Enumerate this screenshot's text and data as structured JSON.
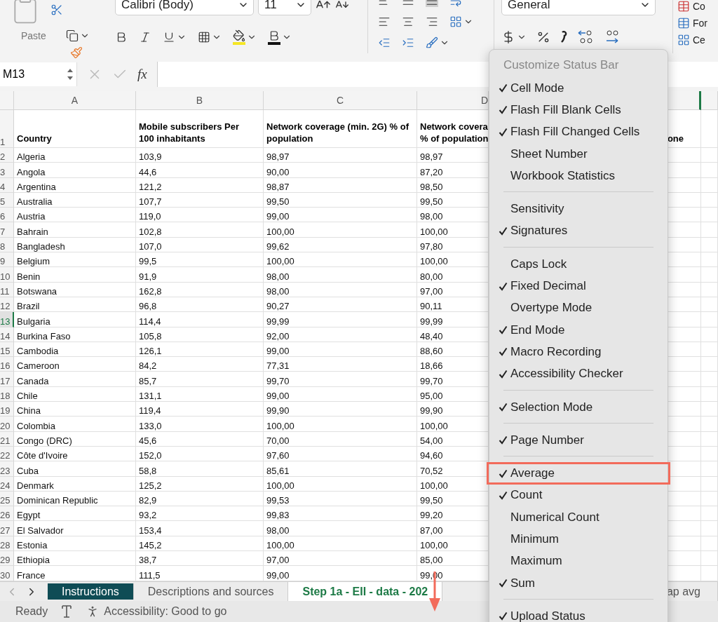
{
  "ribbon": {
    "paste_label": "Paste",
    "font_name": "Calibri (Body)",
    "font_size": "11",
    "number_format": "General",
    "style_labels": [
      "Co",
      "For",
      "Ce"
    ]
  },
  "formula_bar": {
    "name_box": "M13",
    "fx": "fx"
  },
  "sheet": {
    "column_letters": [
      "A",
      "B",
      "C",
      "D"
    ],
    "header_row": {
      "number": "1",
      "cells": [
        [
          "Country"
        ],
        [
          "Mobile subscribers Per",
          "100 inhabitants"
        ],
        [
          "Network coverage (min. 2G) % of",
          "population"
        ],
        [
          "Network covera",
          "% of population"
        ]
      ],
      "column_5": "one"
    },
    "rows": [
      {
        "number": "2",
        "selected": false,
        "cells": [
          "Algeria",
          "103,9",
          "98,97",
          "98,97"
        ]
      },
      {
        "number": "3",
        "selected": false,
        "cells": [
          "Angola",
          "44,6",
          "90,00",
          "87,20"
        ]
      },
      {
        "number": "4",
        "selected": false,
        "cells": [
          "Argentina",
          "121,2",
          "98,87",
          "98,50"
        ]
      },
      {
        "number": "5",
        "selected": false,
        "cells": [
          "Australia",
          "107,7",
          "99,50",
          "99,50"
        ]
      },
      {
        "number": "6",
        "selected": false,
        "cells": [
          "Austria",
          "119,0",
          "99,00",
          "98,00"
        ]
      },
      {
        "number": "7",
        "selected": false,
        "cells": [
          "Bahrain",
          "102,8",
          "100,00",
          "100,00"
        ]
      },
      {
        "number": "8",
        "selected": false,
        "cells": [
          "Bangladesh",
          "107,0",
          "99,62",
          "97,80"
        ]
      },
      {
        "number": "9",
        "selected": false,
        "cells": [
          "Belgium",
          "99,5",
          "100,00",
          "100,00"
        ]
      },
      {
        "number": "10",
        "selected": false,
        "cells": [
          "Benin",
          "91,9",
          "98,00",
          "80,00"
        ]
      },
      {
        "number": "11",
        "selected": false,
        "cells": [
          "Botswana",
          "162,8",
          "98,00",
          "97,00"
        ]
      },
      {
        "number": "12",
        "selected": false,
        "cells": [
          "Brazil",
          "96,8",
          "90,27",
          "90,11"
        ]
      },
      {
        "number": "13",
        "selected": true,
        "cells": [
          "Bulgaria",
          "114,4",
          "99,99",
          "99,99"
        ]
      },
      {
        "number": "14",
        "selected": false,
        "cells": [
          "Burkina Faso",
          "105,8",
          "92,00",
          "48,40"
        ]
      },
      {
        "number": "15",
        "selected": false,
        "cells": [
          "Cambodia",
          "126,1",
          "99,00",
          "88,60"
        ]
      },
      {
        "number": "16",
        "selected": false,
        "cells": [
          "Cameroon",
          "84,2",
          "77,31",
          "18,66"
        ]
      },
      {
        "number": "17",
        "selected": false,
        "cells": [
          "Canada",
          "85,7",
          "99,70",
          "99,70"
        ]
      },
      {
        "number": "18",
        "selected": false,
        "cells": [
          "Chile",
          "131,1",
          "99,00",
          "95,00"
        ]
      },
      {
        "number": "19",
        "selected": false,
        "cells": [
          "China",
          "119,4",
          "99,90",
          "99,90"
        ]
      },
      {
        "number": "20",
        "selected": false,
        "cells": [
          "Colombia",
          "133,0",
          "100,00",
          "100,00"
        ]
      },
      {
        "number": "21",
        "selected": false,
        "cells": [
          "Congo (DRC)",
          "45,6",
          "70,00",
          "54,00"
        ]
      },
      {
        "number": "22",
        "selected": false,
        "cells": [
          "Côte d'Ivoire",
          "152,0",
          "97,60",
          "94,60"
        ]
      },
      {
        "number": "23",
        "selected": false,
        "cells": [
          "Cuba",
          "58,8",
          "85,61",
          "70,52"
        ]
      },
      {
        "number": "24",
        "selected": false,
        "cells": [
          "Denmark",
          "125,2",
          "100,00",
          "100,00"
        ]
      },
      {
        "number": "25",
        "selected": false,
        "cells": [
          "Dominican Republic",
          "82,9",
          "99,53",
          "99,50"
        ]
      },
      {
        "number": "26",
        "selected": false,
        "cells": [
          "Egypt",
          "93,2",
          "99,83",
          "99,20"
        ]
      },
      {
        "number": "27",
        "selected": false,
        "cells": [
          "El Salvador",
          "153,4",
          "98,00",
          "87,00"
        ]
      },
      {
        "number": "28",
        "selected": false,
        "cells": [
          "Estonia",
          "145,2",
          "100,00",
          "100,00"
        ]
      },
      {
        "number": "29",
        "selected": false,
        "cells": [
          "Ethiopia",
          "38,7",
          "97,00",
          "85,00"
        ]
      },
      {
        "number": "30",
        "selected": false,
        "cells": [
          "France",
          "111,5",
          "99,00",
          "99,00"
        ]
      }
    ]
  },
  "sheet_tabs": [
    {
      "label": "Instructions",
      "selected": false,
      "color": "#0f4c55"
    },
    {
      "label": "Descriptions and sources",
      "selected": false
    },
    {
      "label": "Step 1a - EII - data - 202",
      "selected": true
    },
    {
      "label": "ap avg",
      "selected": false
    }
  ],
  "status_bar": {
    "mode": "Ready",
    "accessibility": "Accessibility: Good to go"
  },
  "menu": {
    "title": "Customize Status Bar",
    "groups": [
      [
        {
          "label": "Cell Mode",
          "checked": true,
          "highlighted": false
        },
        {
          "label": "Flash Fill Blank Cells",
          "checked": true,
          "highlighted": false
        },
        {
          "label": "Flash Fill Changed Cells",
          "checked": true,
          "highlighted": false
        },
        {
          "label": "Sheet Number",
          "checked": false,
          "highlighted": false
        },
        {
          "label": "Workbook Statistics",
          "checked": false,
          "highlighted": false
        }
      ],
      [
        {
          "label": "Sensitivity",
          "checked": false,
          "highlighted": false
        },
        {
          "label": "Signatures",
          "checked": true,
          "highlighted": false
        }
      ],
      [
        {
          "label": "Caps Lock",
          "checked": false,
          "highlighted": false
        },
        {
          "label": "Fixed Decimal",
          "checked": true,
          "highlighted": false
        },
        {
          "label": "Overtype Mode",
          "checked": false,
          "highlighted": false
        },
        {
          "label": "End Mode",
          "checked": true,
          "highlighted": false
        },
        {
          "label": "Macro Recording",
          "checked": true,
          "highlighted": false
        },
        {
          "label": "Accessibility Checker",
          "checked": true,
          "highlighted": false
        }
      ],
      [
        {
          "label": "Selection Mode",
          "checked": true,
          "highlighted": false
        }
      ],
      [
        {
          "label": "Page Number",
          "checked": true,
          "highlighted": false
        }
      ],
      [
        {
          "label": "Average",
          "checked": true,
          "highlighted": true
        },
        {
          "label": "Count",
          "checked": true,
          "highlighted": false
        },
        {
          "label": "Numerical Count",
          "checked": false,
          "highlighted": false
        },
        {
          "label": "Minimum",
          "checked": false,
          "highlighted": false
        },
        {
          "label": "Maximum",
          "checked": false,
          "highlighted": false
        },
        {
          "label": "Sum",
          "checked": true,
          "highlighted": false
        }
      ],
      [
        {
          "label": "Upload Status",
          "checked": true,
          "highlighted": false
        }
      ]
    ]
  }
}
